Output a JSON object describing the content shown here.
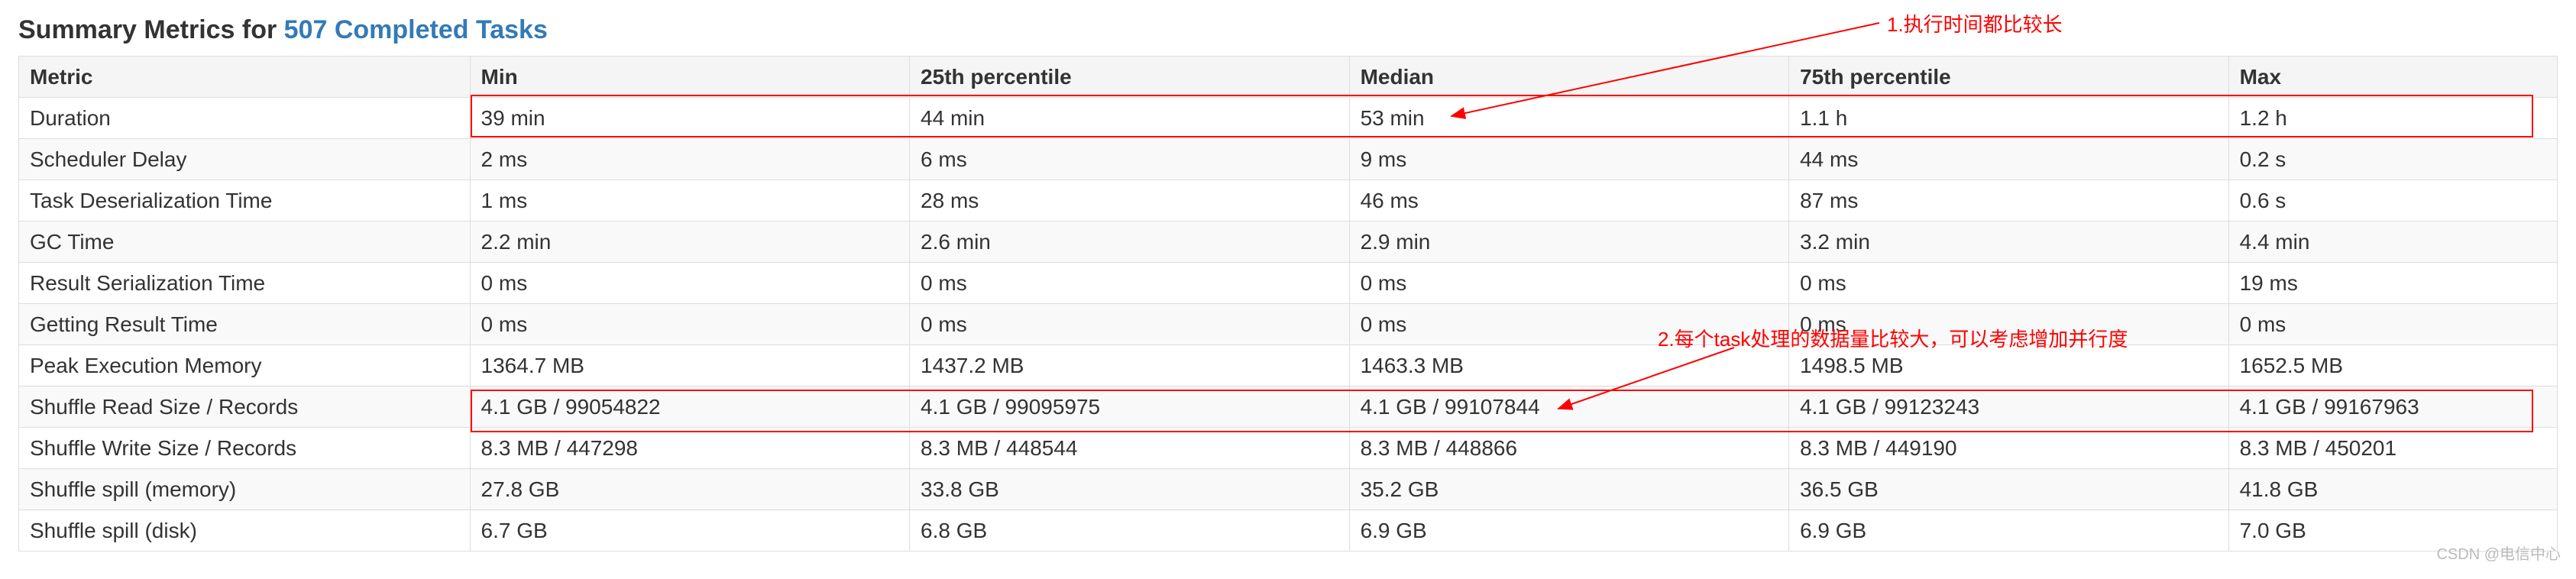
{
  "title_prefix": "Summary Metrics for ",
  "title_link": "507 Completed Tasks",
  "columns": [
    "Metric",
    "Min",
    "25th percentile",
    "Median",
    "75th percentile",
    "Max"
  ],
  "rows": [
    {
      "metric": "Duration",
      "min": "39 min",
      "p25": "44 min",
      "median": "53 min",
      "p75": "1.1 h",
      "max": "1.2 h"
    },
    {
      "metric": "Scheduler Delay",
      "min": "2 ms",
      "p25": "6 ms",
      "median": "9 ms",
      "p75": "44 ms",
      "max": "0.2 s"
    },
    {
      "metric": "Task Deserialization Time",
      "min": "1 ms",
      "p25": "28 ms",
      "median": "46 ms",
      "p75": "87 ms",
      "max": "0.6 s"
    },
    {
      "metric": "GC Time",
      "min": "2.2 min",
      "p25": "2.6 min",
      "median": "2.9 min",
      "p75": "3.2 min",
      "max": "4.4 min"
    },
    {
      "metric": "Result Serialization Time",
      "min": "0 ms",
      "p25": "0 ms",
      "median": "0 ms",
      "p75": "0 ms",
      "max": "19 ms"
    },
    {
      "metric": "Getting Result Time",
      "min": "0 ms",
      "p25": "0 ms",
      "median": "0 ms",
      "p75": "0 ms",
      "max": "0 ms"
    },
    {
      "metric": "Peak Execution Memory",
      "min": "1364.7 MB",
      "p25": "1437.2 MB",
      "median": "1463.3 MB",
      "p75": "1498.5 MB",
      "max": "1652.5 MB"
    },
    {
      "metric": "Shuffle Read Size / Records",
      "min": "4.1 GB / 99054822",
      "p25": "4.1 GB / 99095975",
      "median": "4.1 GB / 99107844",
      "p75": "4.1 GB / 99123243",
      "max": "4.1 GB / 99167963"
    },
    {
      "metric": "Shuffle Write Size / Records",
      "min": "8.3 MB / 447298",
      "p25": "8.3 MB / 448544",
      "median": "8.3 MB / 448866",
      "p75": "8.3 MB / 449190",
      "max": "8.3 MB / 450201"
    },
    {
      "metric": "Shuffle spill (memory)",
      "min": "27.8 GB",
      "p25": "33.8 GB",
      "median": "35.2 GB",
      "p75": "36.5 GB",
      "max": "41.8 GB"
    },
    {
      "metric": "Shuffle spill (disk)",
      "min": "6.7 GB",
      "p25": "6.8 GB",
      "median": "6.9 GB",
      "p75": "6.9 GB",
      "max": "7.0 GB"
    }
  ],
  "annotations": {
    "note1": "1.执行时间都比较长",
    "note2": "2.每个task处理的数据量比较大，可以考虑增加并行度"
  },
  "watermark": "CSDN @电信中心"
}
